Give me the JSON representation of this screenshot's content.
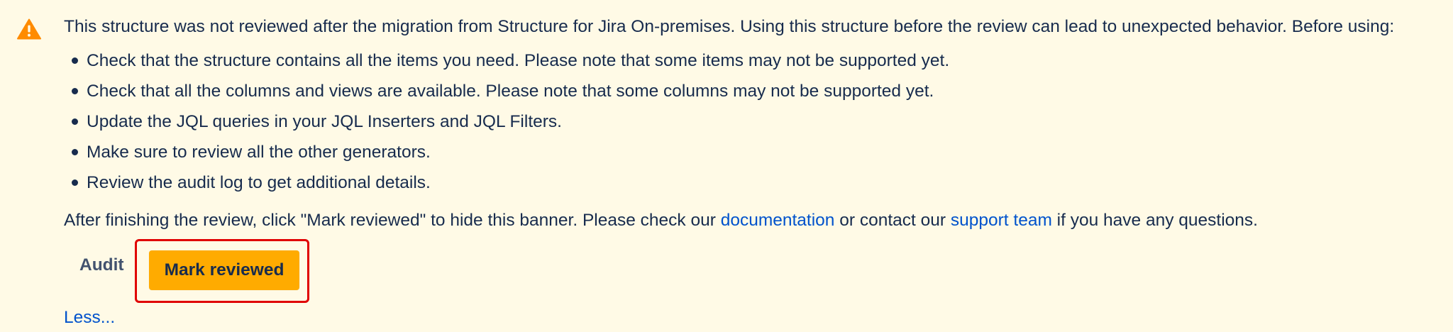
{
  "colors": {
    "banner_background": "#fffae6",
    "warning_icon": "#ff8b00",
    "primary_button": "#ffab00",
    "link": "#0052cc",
    "text": "#172b4d",
    "highlight_border": "#e00000"
  },
  "banner": {
    "icon": "warning-triangle-icon",
    "intro": "This structure was not reviewed after the migration from Structure for Jira On-premises. Using this structure before the review can lead to unexpected behavior. Before using:",
    "checklist": [
      "Check that the structure contains all the items you need. Please note that some items may not be supported yet.",
      "Check that all the columns and views are available. Please note that some columns may not be supported yet.",
      "Update the JQL queries in your JQL Inserters and JQL Filters.",
      "Make sure to review all the other generators.",
      "Review the audit log to get additional details."
    ],
    "after": {
      "part1": "After finishing the review, click \"Mark reviewed\" to hide this banner. Please check our ",
      "documentation_link": "documentation",
      "part2": " or contact our ",
      "support_link": "support team",
      "part3": " if you have any questions."
    },
    "actions": {
      "audit_label": "Audit",
      "mark_reviewed_label": "Mark reviewed"
    },
    "less_link": "Less..."
  }
}
